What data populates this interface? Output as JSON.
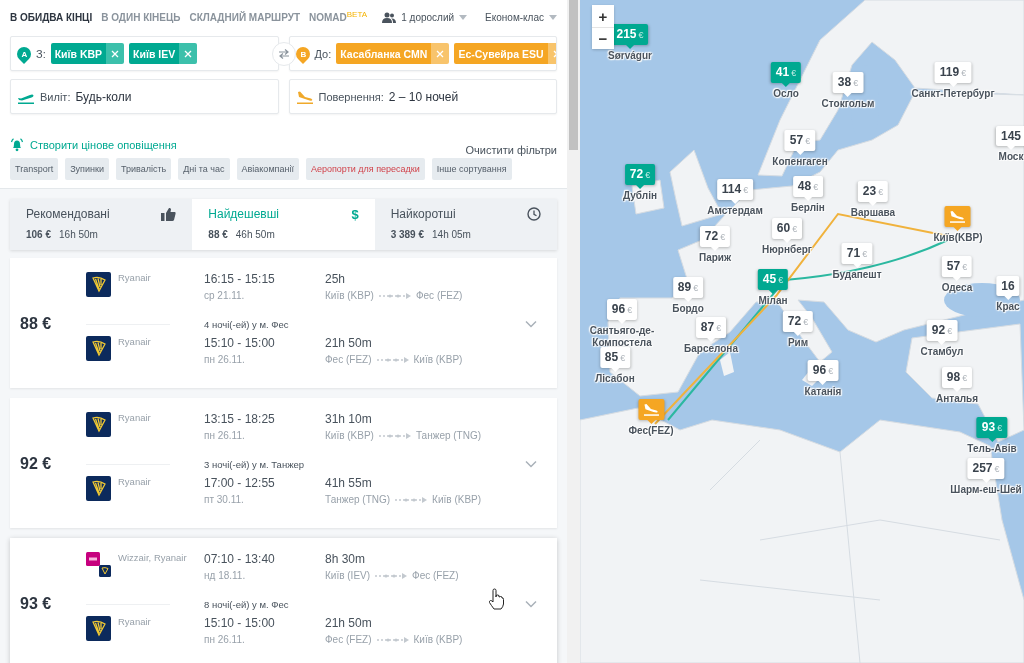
{
  "trip_types": [
    {
      "label": "В ОБИДВА КІНЦІ",
      "selected": true
    },
    {
      "label": "В ОДИН КІНЕЦЬ",
      "selected": false
    },
    {
      "label": "СКЛАДНИЙ МАРШРУТ",
      "selected": false
    },
    {
      "label": "NOMAD",
      "selected": false,
      "badge": "BETA"
    }
  ],
  "passengers": "1 дорослий",
  "cabin": "Економ-клас",
  "from": {
    "pin": "A",
    "label": "З:",
    "chips": [
      "Київ KBP",
      "Київ IEV"
    ]
  },
  "to": {
    "pin": "B",
    "label": "До:",
    "chips": [
      "Касабланка CMN",
      "Ес-Сувейра ESU"
    ]
  },
  "departure": {
    "label": "Виліт:",
    "value": "Будь-коли"
  },
  "return": {
    "label": "Повернення:",
    "value": "2 – 10 ночей"
  },
  "price_alert": "Створити цінове оповіщення",
  "clear_filters": "Очистити фільтри",
  "filters": [
    {
      "label": "Transport",
      "highlighted": false
    },
    {
      "label": "Зупинки",
      "highlighted": false
    },
    {
      "label": "Тривалість",
      "highlighted": false
    },
    {
      "label": "Дні та час",
      "highlighted": false
    },
    {
      "label": "Авіакомпанії",
      "highlighted": false
    },
    {
      "label": "Аеропорти для пересадки",
      "highlighted": true
    },
    {
      "label": "Інше сортування",
      "highlighted": false
    }
  ],
  "sort_tabs": [
    {
      "label": "Рекомендовані",
      "price": "106 €",
      "duration": "16h 50m",
      "kind": "thumb",
      "selected": false
    },
    {
      "label": "Найдешевші",
      "price": "88 €",
      "duration": "46h 50m",
      "kind": "symbol",
      "symbol": "$",
      "selected": true
    },
    {
      "label": "Найкоротші",
      "price": "3 389 €",
      "duration": "14h 05m",
      "kind": "clock",
      "selected": false
    }
  ],
  "results": [
    {
      "price": "88 €",
      "stay": "4 ночі(-ей) у м. Фес",
      "hovered": false,
      "legs": [
        {
          "airlines": "Ryanair",
          "logos": [
            {
              "kind": "harp"
            }
          ],
          "times": "16:15 - 15:15",
          "date": "ср 21.11.",
          "duration": "25h",
          "from": "Київ (KBP)",
          "to": "Фес (FEZ)"
        },
        {
          "airlines": "Ryanair",
          "logos": [
            {
              "kind": "harp"
            }
          ],
          "times": "15:10 - 15:00",
          "date": "пн 26.11.",
          "duration": "21h 50m",
          "from": "Фес (FEZ)",
          "to": "Київ (KBP)"
        }
      ]
    },
    {
      "price": "92 €",
      "stay": "3 ночі(-ей) у м. Танжер",
      "hovered": false,
      "legs": [
        {
          "airlines": "Ryanair",
          "logos": [
            {
              "kind": "harp"
            }
          ],
          "times": "13:15 - 18:25",
          "date": "пн 26.11.",
          "duration": "31h 10m",
          "from": "Київ (KBP)",
          "to": "Танжер (TNG)"
        },
        {
          "airlines": "Ryanair",
          "logos": [
            {
              "kind": "harp"
            }
          ],
          "times": "17:00 - 12:55",
          "date": "пт 30.11.",
          "duration": "41h 55m",
          "from": "Танжер (TNG)",
          "to": "Київ (KBP)"
        }
      ]
    },
    {
      "price": "93 €",
      "stay": "8 ночі(-ей) у м. Фес",
      "hovered": true,
      "legs": [
        {
          "airlines": "Wizzair, Ryanair",
          "logos": [
            {
              "kind": "pink"
            },
            {
              "kind": "harp"
            }
          ],
          "times": "07:10 - 13:40",
          "date": "нд 18.11.",
          "duration": "8h 30m",
          "from": "Київ (IEV)",
          "to": "Фес (FEZ)"
        },
        {
          "airlines": "Ryanair",
          "logos": [
            {
              "kind": "harp"
            }
          ],
          "times": "15:10 - 15:00",
          "date": "пн 26.11.",
          "duration": "21h 50m",
          "from": "Фес (FEZ)",
          "to": "Київ (KBP)"
        }
      ]
    }
  ],
  "map": {
    "zoom_controls": [
      "+",
      "−"
    ],
    "markers": [
      {
        "kind": "highlight",
        "price": "215",
        "currency": "€",
        "city": "Sørvágur"
      },
      {
        "kind": "highlight",
        "price": "41",
        "currency": "€",
        "city": "Осло"
      },
      {
        "kind": "plain",
        "price": "38",
        "currency": "€",
        "city": "Стокгольм"
      },
      {
        "kind": "plain",
        "price": "119",
        "currency": "€",
        "city": "Санкт-Петербург"
      },
      {
        "kind": "plain",
        "price": "57",
        "currency": "€",
        "city": "Копенгаген"
      },
      {
        "kind": "plain",
        "price": "145",
        "city": "Моск"
      },
      {
        "kind": "highlight",
        "price": "72",
        "currency": "€",
        "city": "Дублін"
      },
      {
        "kind": "plain",
        "price": "114",
        "currency": "€",
        "city": "Амстердам"
      },
      {
        "kind": "plain",
        "price": "48",
        "currency": "€",
        "city": "Берлін"
      },
      {
        "kind": "plain",
        "price": "23",
        "currency": "€",
        "city": "Варшава"
      },
      {
        "kind": "plain",
        "price": "72",
        "currency": "€",
        "city": "Париж"
      },
      {
        "kind": "plain",
        "price": "60",
        "currency": "€",
        "city": "Нюрнберг"
      },
      {
        "kind": "plain",
        "price": "71",
        "currency": "€",
        "city": "Будапешт"
      },
      {
        "kind": "airport",
        "city": "Київ(KBP)"
      },
      {
        "kind": "plain",
        "price": "57",
        "currency": "€",
        "city": "Одеса"
      },
      {
        "kind": "plain",
        "price": "16",
        "city": "Крас"
      },
      {
        "kind": "plain",
        "price": "96",
        "currency": "€",
        "city": "Сантьяго-де-Компостела"
      },
      {
        "kind": "plain",
        "price": "89",
        "currency": "€",
        "city": "Бордо"
      },
      {
        "kind": "highlight",
        "price": "45",
        "currency": "€",
        "city": "Мілан"
      },
      {
        "kind": "plain",
        "price": "87",
        "currency": "€",
        "city": "Барселона"
      },
      {
        "kind": "plain",
        "price": "72",
        "currency": "€",
        "city": "Рим"
      },
      {
        "kind": "plain",
        "price": "92",
        "currency": "€",
        "city": "Стамбул"
      },
      {
        "kind": "plain",
        "price": "85",
        "currency": "€",
        "city": "Лісабон"
      },
      {
        "kind": "plain",
        "price": "96",
        "currency": "€",
        "city": "Катанія"
      },
      {
        "kind": "plain",
        "price": "98",
        "currency": "€",
        "city": "Анталья"
      },
      {
        "kind": "airport",
        "city": "Фес(FEZ)"
      },
      {
        "kind": "highlight",
        "price": "93",
        "currency": "€",
        "city": "Тель-Авів"
      },
      {
        "kind": "plain",
        "price": "257",
        "currency": "€",
        "city": "Шарм-еш-Шей"
      }
    ],
    "routes": [
      {
        "color": "#2bb8a0"
      },
      {
        "color": "#f0b23c"
      }
    ]
  }
}
